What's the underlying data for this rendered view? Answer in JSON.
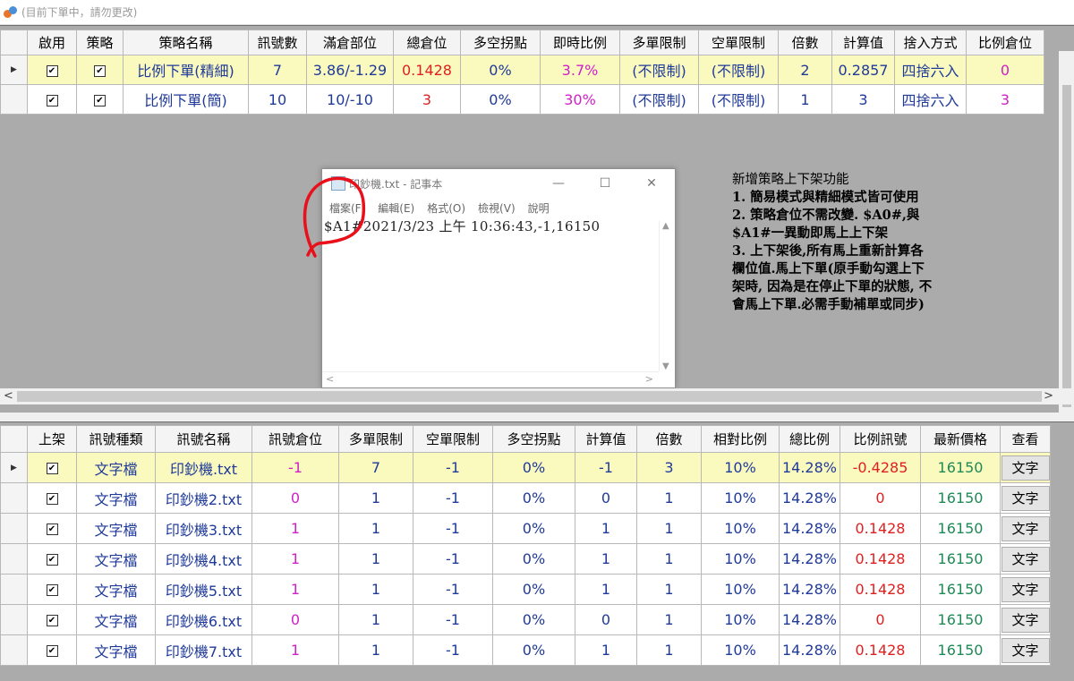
{
  "window": {
    "title": "(目前下單中，請勿更改)"
  },
  "colors": {
    "selected_row": "#fafabf",
    "text_blue": "#1f3a99",
    "text_red": "#e02020",
    "text_magenta": "#d020c8",
    "text_green": "#1f8a55",
    "panel_gray": "#ababab"
  },
  "strategy_table": {
    "headers": [
      "",
      "啟用",
      "策略",
      "策略名稱",
      "訊號數",
      "滿倉部位",
      "總倉位",
      "多空拐點",
      "即時比例",
      "多單限制",
      "空單限制",
      "倍數",
      "計算值",
      "捨入方式",
      "比例倉位"
    ],
    "rows": [
      {
        "enabled": true,
        "strategy": true,
        "name": "比例下單(精細)",
        "signal_count": "7",
        "full_position": "3.86/-1.29",
        "total_position": "0.1428",
        "turning_point": "0%",
        "live_ratio": "3.7%",
        "long_limit": "(不限制)",
        "short_limit": "(不限制)",
        "multiplier": "2",
        "calc_value": "0.2857",
        "rounding": "四捨六入",
        "ratio_position": "0"
      },
      {
        "enabled": true,
        "strategy": true,
        "name": "比例下單(簡)",
        "signal_count": "10",
        "full_position": "10/-10",
        "total_position": "3",
        "turning_point": "0%",
        "live_ratio": "30%",
        "long_limit": "(不限制)",
        "short_limit": "(不限制)",
        "multiplier": "1",
        "calc_value": "3",
        "rounding": "四捨六入",
        "ratio_position": "3"
      }
    ]
  },
  "annotation": {
    "lines": [
      "新增策略上下架功能",
      "1. 簡易模式與精細模式皆可使用",
      "2. 策略倉位不需改變. $A0#,與",
      "$A1#一異動即馬上上下架",
      "3. 上下架後,所有馬上重新計算各",
      "欄位值.馬上下單(原手動勾選上下",
      "架時, 因為是在停止下單的狀態, 不",
      "會馬上下單.必需手動補單或同步)"
    ]
  },
  "notepad": {
    "title": "印鈔機.txt - 記事本",
    "minimize_icon": "minimize-icon",
    "maximize_icon": "maximize-icon",
    "close_icon": "close-icon",
    "menu": [
      "檔案(F)",
      "編輯(E)",
      "格式(O)",
      "檢視(V)",
      "說明"
    ],
    "content": "$A1#2021/3/23 上午 10:36:43,-1,16150"
  },
  "signal_table": {
    "headers": [
      "",
      "上架",
      "訊號種類",
      "訊號名稱",
      "訊號倉位",
      "多單限制",
      "空單限制",
      "多空拐點",
      "計算值",
      "倍數",
      "相對比例",
      "總比例",
      "比例訊號",
      "最新價格",
      "查看"
    ],
    "rows": [
      {
        "listed": true,
        "type": "文字檔",
        "name": "印鈔機.txt",
        "position": "-1",
        "long_limit": "7",
        "short_limit": "-1",
        "turning_point": "0%",
        "calc_value": "-1",
        "multiplier": "3",
        "relative_ratio": "10%",
        "total_ratio": "14.28%",
        "ratio_signal": "-0.4285",
        "latest_price": "16150",
        "view": "文字"
      },
      {
        "listed": true,
        "type": "文字檔",
        "name": "印鈔機2.txt",
        "position": "0",
        "long_limit": "1",
        "short_limit": "-1",
        "turning_point": "0%",
        "calc_value": "0",
        "multiplier": "1",
        "relative_ratio": "10%",
        "total_ratio": "14.28%",
        "ratio_signal": "0",
        "latest_price": "16150",
        "view": "文字"
      },
      {
        "listed": true,
        "type": "文字檔",
        "name": "印鈔機3.txt",
        "position": "1",
        "long_limit": "1",
        "short_limit": "-1",
        "turning_point": "0%",
        "calc_value": "1",
        "multiplier": "1",
        "relative_ratio": "10%",
        "total_ratio": "14.28%",
        "ratio_signal": "0.1428",
        "latest_price": "16150",
        "view": "文字"
      },
      {
        "listed": true,
        "type": "文字檔",
        "name": "印鈔機4.txt",
        "position": "1",
        "long_limit": "1",
        "short_limit": "-1",
        "turning_point": "0%",
        "calc_value": "1",
        "multiplier": "1",
        "relative_ratio": "10%",
        "total_ratio": "14.28%",
        "ratio_signal": "0.1428",
        "latest_price": "16150",
        "view": "文字"
      },
      {
        "listed": true,
        "type": "文字檔",
        "name": "印鈔機5.txt",
        "position": "1",
        "long_limit": "1",
        "short_limit": "-1",
        "turning_point": "0%",
        "calc_value": "1",
        "multiplier": "1",
        "relative_ratio": "10%",
        "total_ratio": "14.28%",
        "ratio_signal": "0.1428",
        "latest_price": "16150",
        "view": "文字"
      },
      {
        "listed": true,
        "type": "文字檔",
        "name": "印鈔機6.txt",
        "position": "0",
        "long_limit": "1",
        "short_limit": "-1",
        "turning_point": "0%",
        "calc_value": "0",
        "multiplier": "1",
        "relative_ratio": "10%",
        "total_ratio": "14.28%",
        "ratio_signal": "0",
        "latest_price": "16150",
        "view": "文字"
      },
      {
        "listed": true,
        "type": "文字檔",
        "name": "印鈔機7.txt",
        "position": "1",
        "long_limit": "1",
        "short_limit": "-1",
        "turning_point": "0%",
        "calc_value": "1",
        "multiplier": "1",
        "relative_ratio": "10%",
        "total_ratio": "14.28%",
        "ratio_signal": "0.1428",
        "latest_price": "16150",
        "view": "文字"
      }
    ]
  }
}
